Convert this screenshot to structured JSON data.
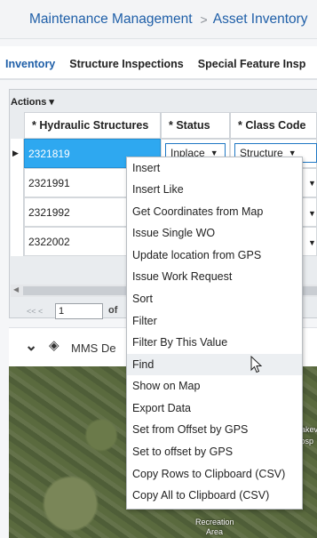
{
  "breadcrumb": {
    "module": "Maintenance Management",
    "separator": ">",
    "page": "Asset Inventory"
  },
  "tabs": [
    {
      "label": "Inventory",
      "active": true
    },
    {
      "label": "Structure Inspections",
      "active": false
    },
    {
      "label": "Special Feature Insp",
      "active": false
    }
  ],
  "grid": {
    "actions_label": "Actions ▾",
    "columns": [
      "* Hydraulic Structures",
      "* Status",
      "* Class Code"
    ],
    "rows": [
      {
        "id": "2321819",
        "status": "Inplace",
        "class_code": "Structure",
        "selected": true
      },
      {
        "id": "2321991"
      },
      {
        "id": "2321992"
      },
      {
        "id": "2322002"
      }
    ],
    "pager": {
      "prev": "<< <",
      "page": "1",
      "of": "of"
    }
  },
  "map_toolbar": {
    "collapse_icon": "chevrons-down-icon",
    "layers_icon": "layers-icon",
    "label": "MMS De"
  },
  "map_labels": {
    "recreation": "Recreation",
    "area": "Area",
    "lakev": "Lakev",
    "hosp": "Hosp"
  },
  "context_menu": {
    "items": [
      "Insert",
      "Insert Like",
      "Get Coordinates from Map",
      "Issue Single WO",
      "Update location from GPS",
      "Issue Work Request",
      "Sort",
      "Filter",
      "Filter By This Value",
      "Find",
      "Show on Map",
      "Export Data",
      "Set from Offset by GPS",
      "Set to offset by GPS",
      "Copy Rows to Clipboard (CSV)",
      "Copy All to Clipboard (CSV)"
    ],
    "hovered_index": 9
  },
  "colors": {
    "accent": "#1f5fa8",
    "selection": "#2ea8f0"
  }
}
